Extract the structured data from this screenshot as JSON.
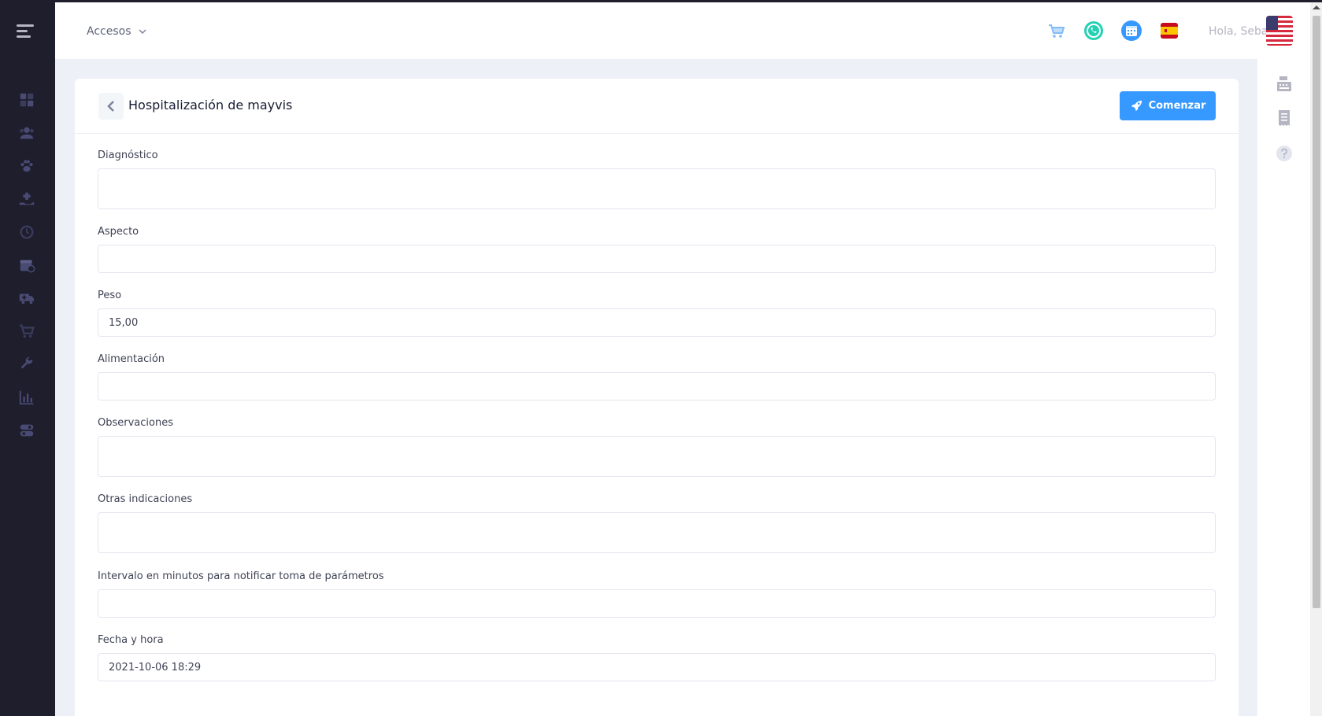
{
  "header": {
    "accesos_label": "Accesos",
    "greeting": "Hola, Seba"
  },
  "page": {
    "title": "Hospitalización de mayvis",
    "start_button": "Comenzar"
  },
  "form": {
    "fields": [
      {
        "label": "Diagnóstico",
        "value": ""
      },
      {
        "label": "Aspecto",
        "value": ""
      },
      {
        "label": "Peso",
        "value": "15,00"
      },
      {
        "label": "Alimentación",
        "value": ""
      },
      {
        "label": "Observaciones",
        "value": ""
      },
      {
        "label": "Otras indicaciones",
        "value": ""
      },
      {
        "label": "Intervalo en minutos para notificar toma de parámetros",
        "value": ""
      },
      {
        "label": "Fecha y hora",
        "value": "2021-10-06 18:29"
      }
    ]
  },
  "colors": {
    "sidebar": "#1e1e2d",
    "primary": "#3699ff",
    "whatsapp": "#25d0b3",
    "background": "#eef0f8"
  },
  "icons": {
    "sidebar": [
      "dashboard-icon",
      "clients-icon",
      "paw-icon",
      "hand-medical-icon",
      "history-icon",
      "calendar-icon",
      "ambulance-icon",
      "cart-icon",
      "wrench-icon",
      "chart-icon",
      "toggle-icon"
    ],
    "header": [
      "cart-icon",
      "whatsapp-icon",
      "calendar-icon",
      "spain-flag-icon",
      "us-flag-icon"
    ],
    "aside": [
      "cash-register-icon",
      "receipt-icon",
      "help-icon"
    ]
  }
}
